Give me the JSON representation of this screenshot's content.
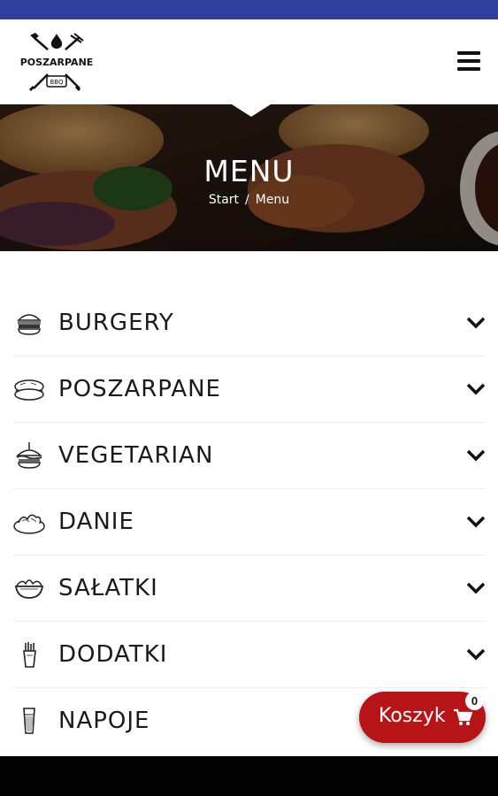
{
  "logo": {
    "text": "POSZARPANE",
    "sub": "BBQ"
  },
  "hero": {
    "title": "MENU",
    "breadcrumb": {
      "home": "Start",
      "separator": "/",
      "current": "Menu"
    }
  },
  "categories": [
    {
      "label": "BURGERY",
      "icon": "burger-icon"
    },
    {
      "label": "POSZARPANE",
      "icon": "sandwich-icon"
    },
    {
      "label": "VEGETARIAN",
      "icon": "veggie-burger-icon"
    },
    {
      "label": "DANIE",
      "icon": "dish-icon"
    },
    {
      "label": "SAŁATKI",
      "icon": "salad-bowl-icon"
    },
    {
      "label": "DODATKI",
      "icon": "fries-icon"
    },
    {
      "label": "NAPOJE",
      "icon": "drink-glass-icon"
    }
  ],
  "cart": {
    "label": "Koszyk",
    "count": "0"
  },
  "colors": {
    "status_bar": "#2f3f9e",
    "cart": "#b71418"
  }
}
